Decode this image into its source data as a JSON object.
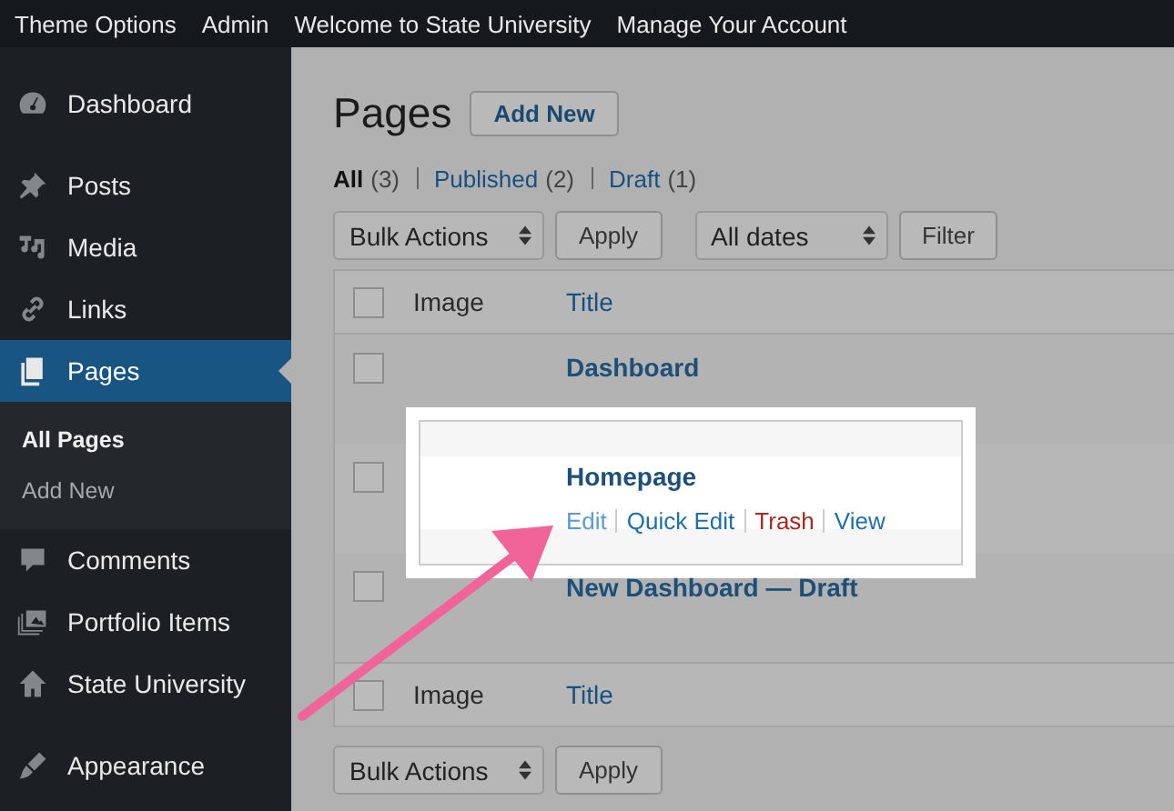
{
  "top_bar": {
    "items": [
      "Theme Options",
      "Admin",
      "Welcome to State University",
      "Manage Your Account"
    ]
  },
  "sidebar": {
    "groups": [
      [
        {
          "label": "Dashboard",
          "selected": false
        }
      ],
      [
        {
          "label": "Posts",
          "selected": false
        },
        {
          "label": "Media",
          "selected": false
        },
        {
          "label": "Links",
          "selected": false
        },
        {
          "label": "Pages",
          "selected": true,
          "children": [
            {
              "label": "All Pages",
              "selected": true
            },
            {
              "label": "Add New",
              "selected": false
            }
          ]
        },
        {
          "label": "Comments",
          "selected": false
        },
        {
          "label": "Portfolio Items",
          "selected": false
        },
        {
          "label": "State University",
          "selected": false
        }
      ],
      [
        {
          "label": "Appearance",
          "selected": false
        }
      ]
    ]
  },
  "page": {
    "title": "Pages",
    "add_new": "Add New"
  },
  "filters": [
    {
      "label": "All",
      "count": "(3)",
      "selected": true
    },
    {
      "label": "Published",
      "count": "(2)",
      "selected": false
    },
    {
      "label": "Draft",
      "count": "(1)",
      "selected": false
    }
  ],
  "top_actions": {
    "bulk_select": "Bulk Actions",
    "apply": "Apply",
    "date_select": "All dates",
    "filter": "Filter"
  },
  "table": {
    "columns": [
      "Image",
      "Title"
    ],
    "header_checked": false,
    "rows": [
      {
        "title": "Dashboard",
        "checked": false,
        "highlighted": false
      },
      {
        "title": "Homepage",
        "checked": false,
        "highlighted": true,
        "actions": [
          {
            "label": "Edit",
            "kind": "edit",
            "hovered": true
          },
          {
            "label": "Quick Edit",
            "kind": "edit",
            "hovered": false
          },
          {
            "label": "Trash",
            "kind": "delete",
            "hovered": false
          },
          {
            "label": "View",
            "kind": "edit",
            "hovered": false
          }
        ]
      },
      {
        "title": "New Dashboard — Draft",
        "checked": false,
        "highlighted": false
      }
    ],
    "footer_columns": [
      "Image",
      "Title"
    ],
    "footer_checked": false
  },
  "bottom_actions": {
    "bulk_select": "Bulk Actions",
    "apply": "Apply"
  }
}
